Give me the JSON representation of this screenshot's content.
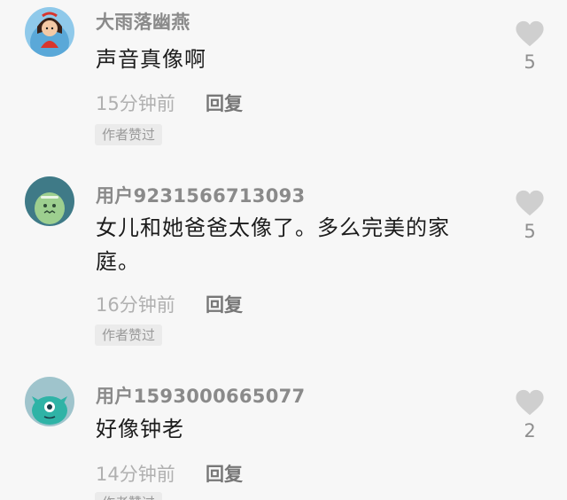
{
  "comments": [
    {
      "username": "大雨落幽燕",
      "text": "声音真像啊",
      "time": "15分钟前",
      "reply_label": "回复",
      "badge": "作者赞过",
      "likes": "5",
      "avatar_icon": "cartoon-girl-avatar-icon"
    },
    {
      "username": "用户9231566713093",
      "text": "女儿和她爸爸太像了。多么完美的家庭。",
      "time": "16分钟前",
      "reply_label": "回复",
      "badge": "作者赞过",
      "likes": "5",
      "avatar_icon": "green-monster-avatar-icon"
    },
    {
      "username": "用户1593000665077",
      "text": "好像钟老",
      "time": "14分钟前",
      "reply_label": "回复",
      "badge": "作者赞过",
      "likes": "2",
      "avatar_icon": "teal-monster-avatar-icon"
    }
  ],
  "colors": {
    "background": "#f7f7f7",
    "heart": "#cfcfcf",
    "badge_bg": "#ebebeb"
  }
}
